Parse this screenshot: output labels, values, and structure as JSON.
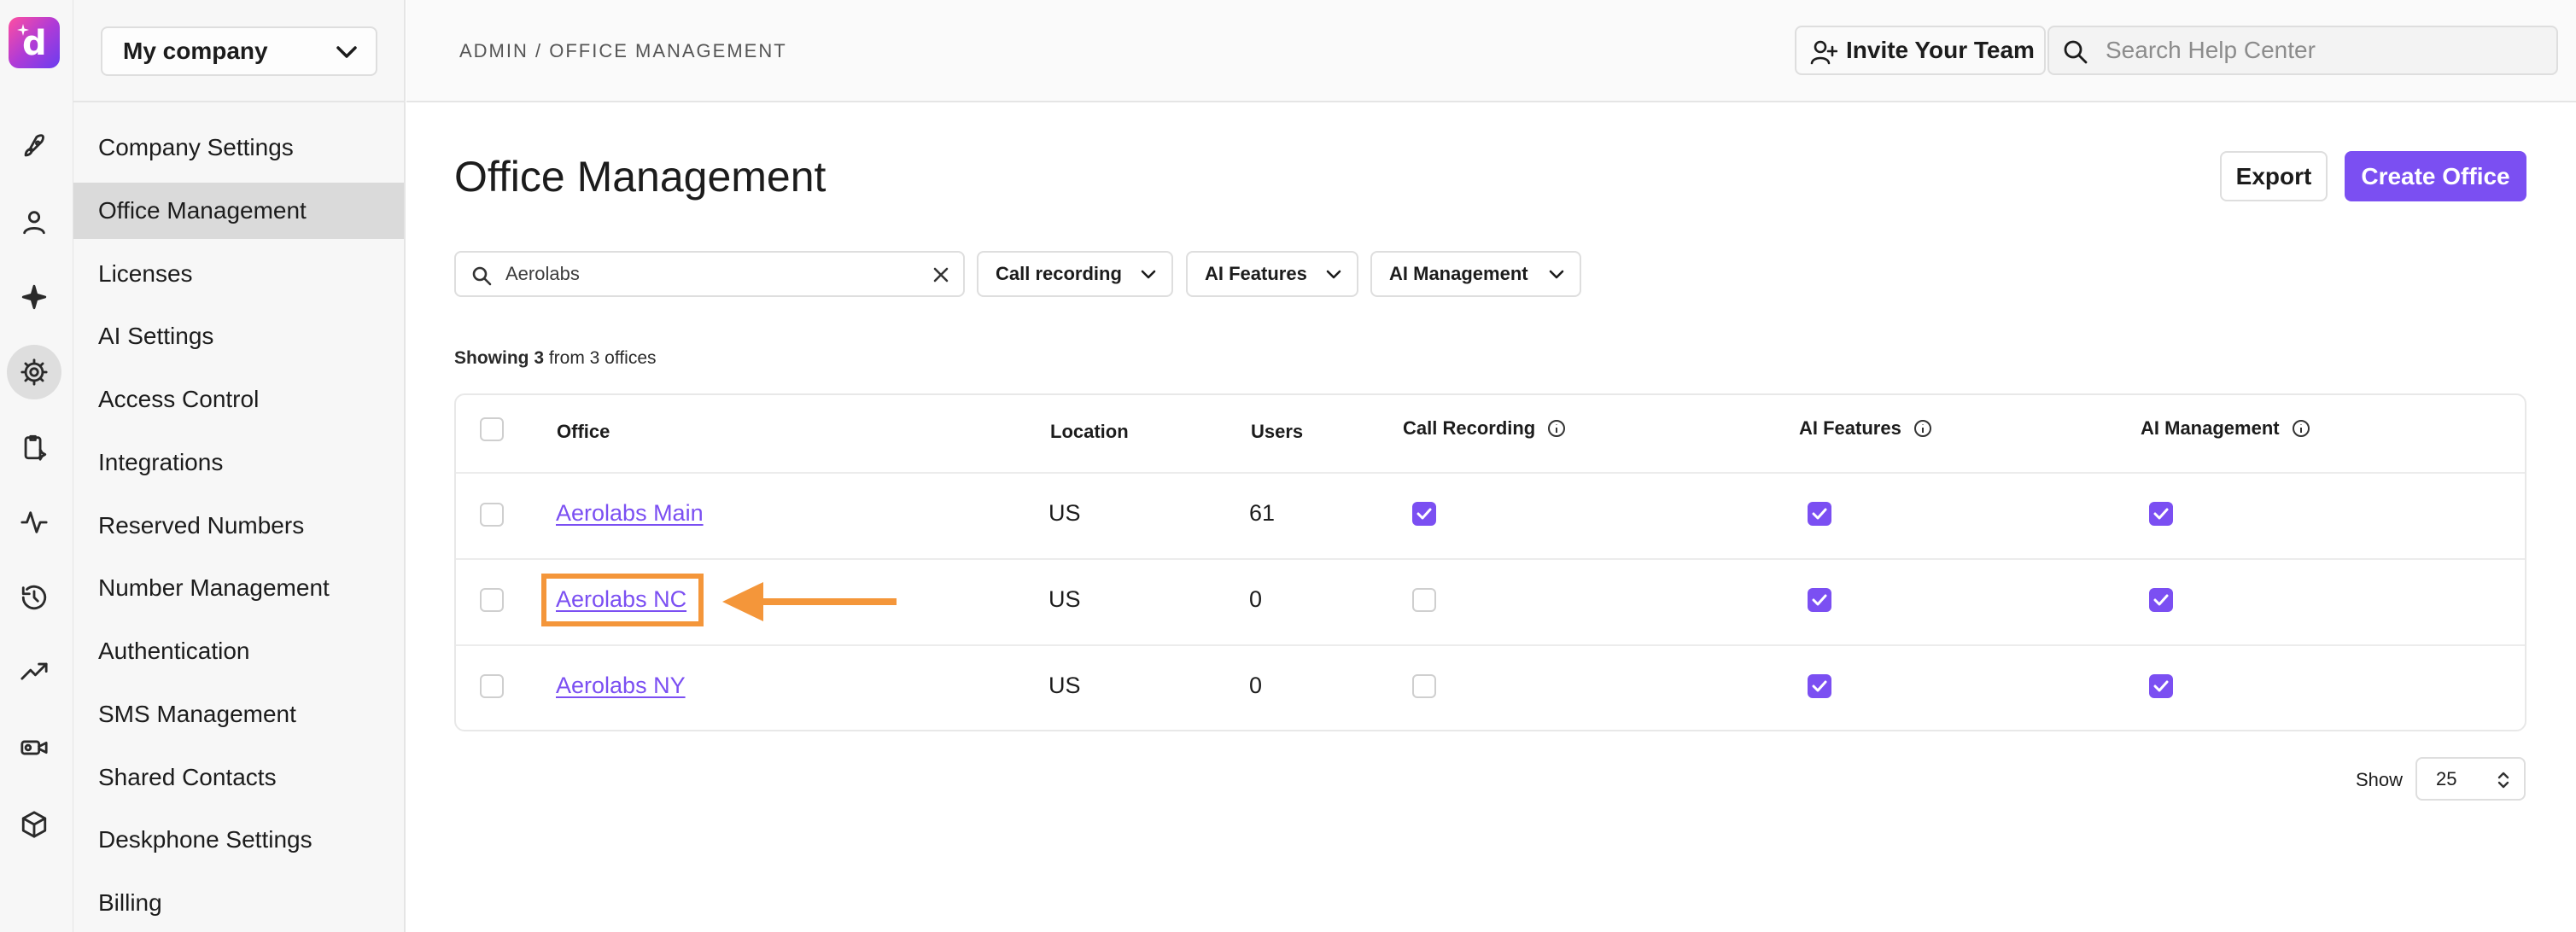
{
  "app": {
    "logo_letter": "d",
    "logo_icon": "dialpad-logo",
    "accent_color": "#7b4ff2",
    "highlight_color": "#f4963a"
  },
  "rail_icons": [
    "rocket-icon",
    "user-icon",
    "sparkle-icon",
    "gear-icon",
    "clipboard-icon",
    "pulse-icon",
    "history-icon",
    "trending-icon",
    "video-icon",
    "cube-icon"
  ],
  "sidebar": {
    "company": "My company",
    "items": [
      {
        "label": "Company Settings"
      },
      {
        "label": "Office Management"
      },
      {
        "label": "Licenses"
      },
      {
        "label": "AI Settings"
      },
      {
        "label": "Access Control"
      },
      {
        "label": "Integrations"
      },
      {
        "label": "Reserved Numbers"
      },
      {
        "label": "Number Management"
      },
      {
        "label": "Authentication"
      },
      {
        "label": "SMS Management"
      },
      {
        "label": "Shared Contacts"
      },
      {
        "label": "Deskphone Settings"
      },
      {
        "label": "Billing"
      }
    ]
  },
  "header": {
    "breadcrumb": "ADMIN / OFFICE MANAGEMENT",
    "invite_label": "Invite Your Team",
    "search_placeholder": "Search Help Center"
  },
  "main": {
    "title": "Office Management",
    "export_label": "Export",
    "create_label": "Create Office",
    "search_value": "Aerolabs",
    "filters": [
      "Call recording",
      "AI Features",
      "AI Management"
    ],
    "showing_count": "Showing 3",
    "showing_rest": " from 3 offices",
    "columns": [
      "Office",
      "Location",
      "Users",
      "Call Recording",
      "AI Features",
      "AI Management"
    ],
    "rows": [
      {
        "office": "Aerolabs Main",
        "location": "US",
        "users": "61",
        "call_recording": true,
        "ai_features": true,
        "ai_management": true
      },
      {
        "office": "Aerolabs NC",
        "location": "US",
        "users": "0",
        "call_recording": false,
        "ai_features": true,
        "ai_management": true
      },
      {
        "office": "Aerolabs NY",
        "location": "US",
        "users": "0",
        "call_recording": false,
        "ai_features": true,
        "ai_management": true
      }
    ],
    "show_label": "Show",
    "page_size": "25"
  }
}
